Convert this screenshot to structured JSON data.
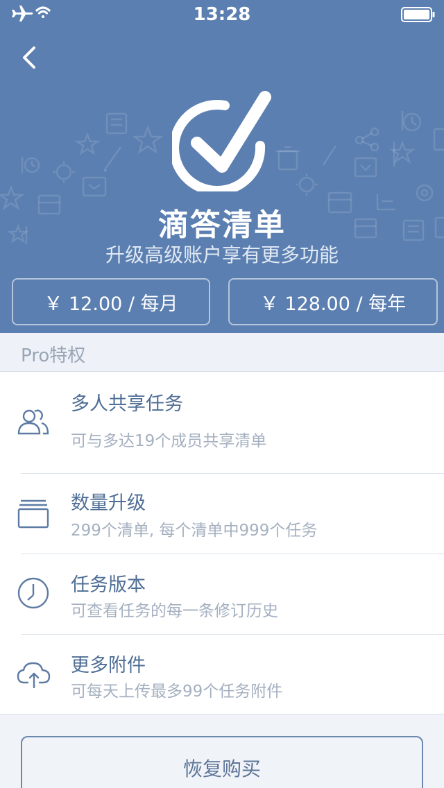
{
  "status_bar": {
    "time": "13:28",
    "icons": [
      "airplane-icon",
      "wifi-icon",
      "battery-icon"
    ]
  },
  "header": {
    "back_icon": "chevron-left-icon",
    "logo_icon": "checkmark-circle-icon",
    "app_name": "滴答清单",
    "subtitle": "升级高级账户享有更多功能"
  },
  "pricing": {
    "monthly": "￥ 12.00 / 每月",
    "yearly": "￥ 128.00 / 每年"
  },
  "pro_section": {
    "header": "Pro特权",
    "features": [
      {
        "icon": "users-icon",
        "title": "多人共享任务",
        "description": "可与多达19个成员共享清单"
      },
      {
        "icon": "list-box-icon",
        "title": "数量升级",
        "description": "299个清单, 每个清单中999个任务"
      },
      {
        "icon": "clock-icon",
        "title": "任务版本",
        "description": "可查看任务的每一条修订历史"
      },
      {
        "icon": "cloud-upload-icon",
        "title": "更多附件",
        "description": "可每天上传最多99个任务附件"
      }
    ]
  },
  "restore_button": "恢复购买",
  "colors": {
    "header_bg": "#5b7fb0",
    "accent_text": "#4f6e96",
    "muted_text": "#a5b0c0",
    "page_bg": "#f0f3f8"
  }
}
